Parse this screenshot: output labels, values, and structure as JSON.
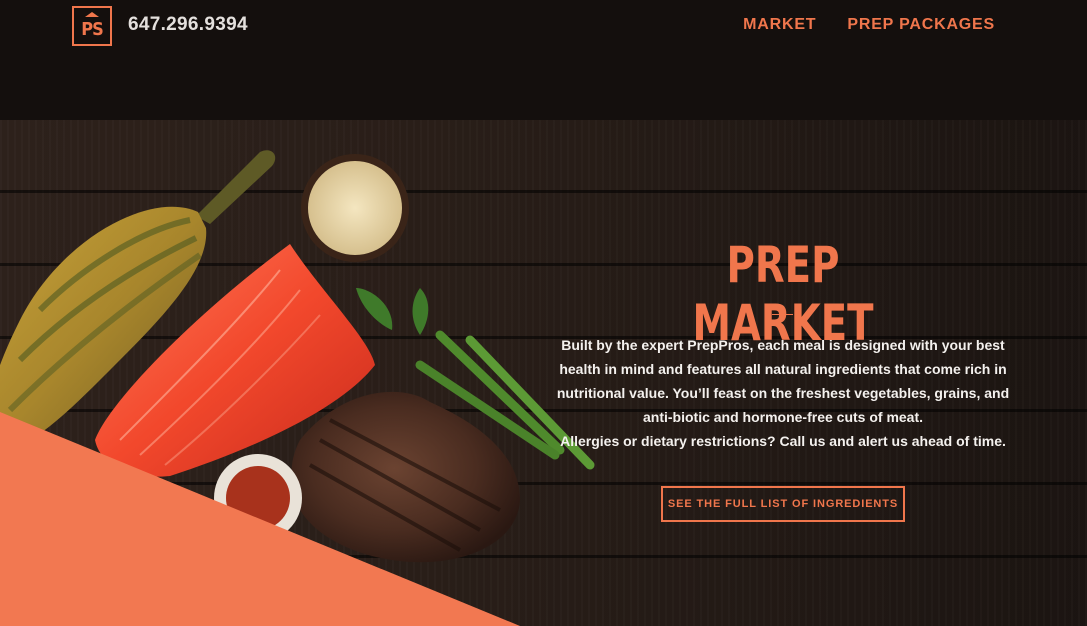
{
  "brand": {
    "logo_text": "PS",
    "phone": "647.296.9394"
  },
  "nav": [
    {
      "label": "MARKET"
    },
    {
      "label": "PREP PACKAGES"
    }
  ],
  "hero": {
    "title": "PREP MARKET",
    "body_lines": [
      "Built by the expert PrepPros, each meal is designed with your best health in mind and features all natural ingredients that come rich in nutritional value. You’ll feast on the freshest vegetables, grains, and anti-biotic and hormone-free cuts of meat.",
      "Allergies or dietary restrictions? Call us and alert us ahead of time."
    ],
    "cta_label": "SEE THE FULL LIST OF INGREDIENTS"
  },
  "colors": {
    "accent": "#f0764c",
    "header_bg": "#140f0d",
    "wood_dark": "#2a1f19",
    "text_light": "#f4f1ee"
  },
  "icons": [
    "ps-logo-icon"
  ]
}
